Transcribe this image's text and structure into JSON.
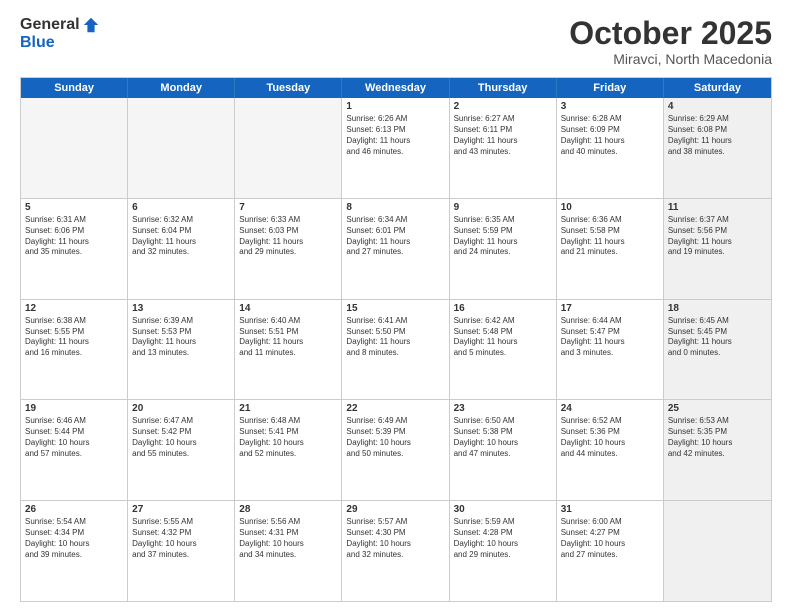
{
  "header": {
    "logo_general": "General",
    "logo_blue": "Blue",
    "month_title": "October 2025",
    "subtitle": "Miravci, North Macedonia"
  },
  "calendar": {
    "days": [
      "Sunday",
      "Monday",
      "Tuesday",
      "Wednesday",
      "Thursday",
      "Friday",
      "Saturday"
    ],
    "rows": [
      [
        {
          "day": "",
          "content": "",
          "empty": true
        },
        {
          "day": "",
          "content": "",
          "empty": true
        },
        {
          "day": "",
          "content": "",
          "empty": true
        },
        {
          "day": "1",
          "content": "Sunrise: 6:26 AM\nSunset: 6:13 PM\nDaylight: 11 hours\nand 46 minutes.",
          "empty": false
        },
        {
          "day": "2",
          "content": "Sunrise: 6:27 AM\nSunset: 6:11 PM\nDaylight: 11 hours\nand 43 minutes.",
          "empty": false
        },
        {
          "day": "3",
          "content": "Sunrise: 6:28 AM\nSunset: 6:09 PM\nDaylight: 11 hours\nand 40 minutes.",
          "empty": false
        },
        {
          "day": "4",
          "content": "Sunrise: 6:29 AM\nSunset: 6:08 PM\nDaylight: 11 hours\nand 38 minutes.",
          "empty": false,
          "shaded": true
        }
      ],
      [
        {
          "day": "5",
          "content": "Sunrise: 6:31 AM\nSunset: 6:06 PM\nDaylight: 11 hours\nand 35 minutes.",
          "empty": false
        },
        {
          "day": "6",
          "content": "Sunrise: 6:32 AM\nSunset: 6:04 PM\nDaylight: 11 hours\nand 32 minutes.",
          "empty": false
        },
        {
          "day": "7",
          "content": "Sunrise: 6:33 AM\nSunset: 6:03 PM\nDaylight: 11 hours\nand 29 minutes.",
          "empty": false
        },
        {
          "day": "8",
          "content": "Sunrise: 6:34 AM\nSunset: 6:01 PM\nDaylight: 11 hours\nand 27 minutes.",
          "empty": false
        },
        {
          "day": "9",
          "content": "Sunrise: 6:35 AM\nSunset: 5:59 PM\nDaylight: 11 hours\nand 24 minutes.",
          "empty": false
        },
        {
          "day": "10",
          "content": "Sunrise: 6:36 AM\nSunset: 5:58 PM\nDaylight: 11 hours\nand 21 minutes.",
          "empty": false
        },
        {
          "day": "11",
          "content": "Sunrise: 6:37 AM\nSunset: 5:56 PM\nDaylight: 11 hours\nand 19 minutes.",
          "empty": false,
          "shaded": true
        }
      ],
      [
        {
          "day": "12",
          "content": "Sunrise: 6:38 AM\nSunset: 5:55 PM\nDaylight: 11 hours\nand 16 minutes.",
          "empty": false
        },
        {
          "day": "13",
          "content": "Sunrise: 6:39 AM\nSunset: 5:53 PM\nDaylight: 11 hours\nand 13 minutes.",
          "empty": false
        },
        {
          "day": "14",
          "content": "Sunrise: 6:40 AM\nSunset: 5:51 PM\nDaylight: 11 hours\nand 11 minutes.",
          "empty": false
        },
        {
          "day": "15",
          "content": "Sunrise: 6:41 AM\nSunset: 5:50 PM\nDaylight: 11 hours\nand 8 minutes.",
          "empty": false
        },
        {
          "day": "16",
          "content": "Sunrise: 6:42 AM\nSunset: 5:48 PM\nDaylight: 11 hours\nand 5 minutes.",
          "empty": false
        },
        {
          "day": "17",
          "content": "Sunrise: 6:44 AM\nSunset: 5:47 PM\nDaylight: 11 hours\nand 3 minutes.",
          "empty": false
        },
        {
          "day": "18",
          "content": "Sunrise: 6:45 AM\nSunset: 5:45 PM\nDaylight: 11 hours\nand 0 minutes.",
          "empty": false,
          "shaded": true
        }
      ],
      [
        {
          "day": "19",
          "content": "Sunrise: 6:46 AM\nSunset: 5:44 PM\nDaylight: 10 hours\nand 57 minutes.",
          "empty": false
        },
        {
          "day": "20",
          "content": "Sunrise: 6:47 AM\nSunset: 5:42 PM\nDaylight: 10 hours\nand 55 minutes.",
          "empty": false
        },
        {
          "day": "21",
          "content": "Sunrise: 6:48 AM\nSunset: 5:41 PM\nDaylight: 10 hours\nand 52 minutes.",
          "empty": false
        },
        {
          "day": "22",
          "content": "Sunrise: 6:49 AM\nSunset: 5:39 PM\nDaylight: 10 hours\nand 50 minutes.",
          "empty": false
        },
        {
          "day": "23",
          "content": "Sunrise: 6:50 AM\nSunset: 5:38 PM\nDaylight: 10 hours\nand 47 minutes.",
          "empty": false
        },
        {
          "day": "24",
          "content": "Sunrise: 6:52 AM\nSunset: 5:36 PM\nDaylight: 10 hours\nand 44 minutes.",
          "empty": false
        },
        {
          "day": "25",
          "content": "Sunrise: 6:53 AM\nSunset: 5:35 PM\nDaylight: 10 hours\nand 42 minutes.",
          "empty": false,
          "shaded": true
        }
      ],
      [
        {
          "day": "26",
          "content": "Sunrise: 5:54 AM\nSunset: 4:34 PM\nDaylight: 10 hours\nand 39 minutes.",
          "empty": false
        },
        {
          "day": "27",
          "content": "Sunrise: 5:55 AM\nSunset: 4:32 PM\nDaylight: 10 hours\nand 37 minutes.",
          "empty": false
        },
        {
          "day": "28",
          "content": "Sunrise: 5:56 AM\nSunset: 4:31 PM\nDaylight: 10 hours\nand 34 minutes.",
          "empty": false
        },
        {
          "day": "29",
          "content": "Sunrise: 5:57 AM\nSunset: 4:30 PM\nDaylight: 10 hours\nand 32 minutes.",
          "empty": false
        },
        {
          "day": "30",
          "content": "Sunrise: 5:59 AM\nSunset: 4:28 PM\nDaylight: 10 hours\nand 29 minutes.",
          "empty": false
        },
        {
          "day": "31",
          "content": "Sunrise: 6:00 AM\nSunset: 4:27 PM\nDaylight: 10 hours\nand 27 minutes.",
          "empty": false
        },
        {
          "day": "",
          "content": "",
          "empty": true,
          "shaded": true
        }
      ]
    ]
  }
}
